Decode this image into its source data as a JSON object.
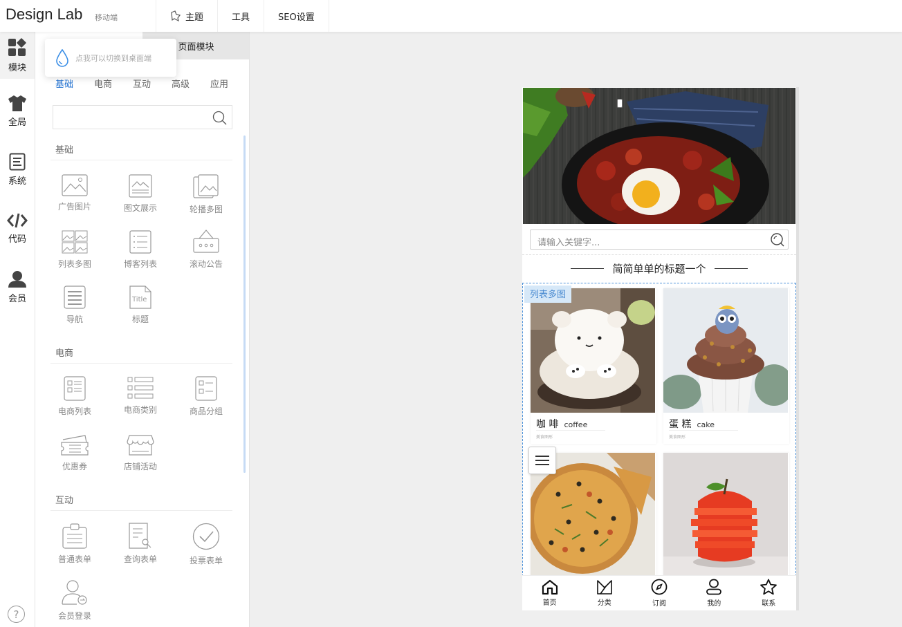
{
  "app": {
    "logo": "Design Lab",
    "device_label": "移动端"
  },
  "top_nav": [
    {
      "label": "主题",
      "icon": "theme-icon"
    },
    {
      "label": "工具"
    },
    {
      "label": "SEO设置"
    }
  ],
  "rail": [
    {
      "label": "模块",
      "icon": "modules-icon",
      "active": true
    },
    {
      "label": "全局",
      "icon": "shirt-icon"
    },
    {
      "label": "系统",
      "icon": "document-icon"
    },
    {
      "label": "代码",
      "icon": "code-icon"
    },
    {
      "label": "会员",
      "icon": "user-icon"
    }
  ],
  "help_label": "?",
  "panel": {
    "tab_right": "页面模块",
    "tooltip": "点我可以切换到桌面端",
    "categories": [
      "基础",
      "电商",
      "互动",
      "高级",
      "应用"
    ],
    "active_category": "基础",
    "sections": [
      {
        "title": "基础",
        "items": [
          "广告图片",
          "图文展示",
          "轮播多图",
          "列表多图",
          "博客列表",
          "滚动公告",
          "导航",
          "标题"
        ]
      },
      {
        "title": "电商",
        "items": [
          "电商列表",
          "电商类别",
          "商品分组",
          "优惠券",
          "店铺活动"
        ]
      },
      {
        "title": "互动",
        "items": [
          "普通表单",
          "查询表单",
          "投票表单",
          "会员登录"
        ]
      }
    ]
  },
  "phone": {
    "search_placeholder": "请输入关键字...",
    "title": "简简单单的标题一个",
    "list_badge": "列表多图",
    "cards": [
      {
        "cn": "咖 啡",
        "en": "coffee",
        "sub": "美食图形"
      },
      {
        "cn": "蛋 糕",
        "en": "cake",
        "sub": "美食图形"
      }
    ],
    "bottom_nav": [
      {
        "label": "首页",
        "icon": "home-icon"
      },
      {
        "label": "分类",
        "icon": "category-icon"
      },
      {
        "label": "订阅",
        "icon": "compass-icon"
      },
      {
        "label": "我的",
        "icon": "profile-icon"
      },
      {
        "label": "联系",
        "icon": "star-icon"
      }
    ]
  },
  "colors": {
    "accent": "#1e6fd0",
    "list_border": "#4a90d9",
    "badge_bg": "#d6e8f8"
  }
}
